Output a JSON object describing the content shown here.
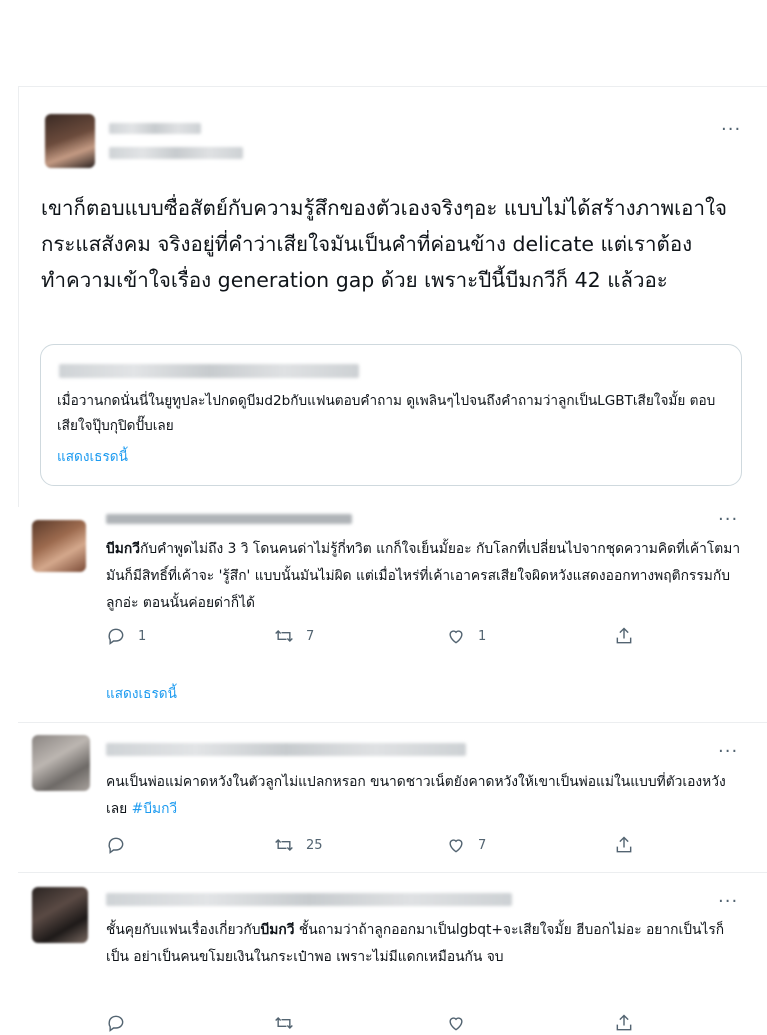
{
  "main_tweet": {
    "text": "เขาก็ตอบแบบซื่อสัตย์กับความรู้สึกของตัวเองจริงๆอะ แบบไม่ได้สร้างภาพเอาใจกระแสสังคม จริงอยู่ที่คำว่าเสียใจมันเป็นคำที่ค่อนข้าง delicate แต่เราต้องทำความเข้าใจเรื่อง generation gap ด้วย เพราะปีนี้บีมกวีก็ 42 แล้วอะ",
    "quote": {
      "text": "เมื่อวานกดนั่นนี่ในยูทูปละไปกดดูบีมd2bกับแฟนตอบคำถาม ดูเพลินๆไปจนถึงคำถามว่าลูกเป็นLGBTเสียใจมั้ย ตอบเสียใจปุ๊บกุปิดปั๊บเลย",
      "show_thread": "แสดงเธรดนี้"
    }
  },
  "replies": [
    {
      "prefix": "บีมกวี",
      "text": "กับคำพูดไม่ถึง 3 วิ โดนคนด่าไม่รู้กี่ทวิต แกก็ใจเย็นมั้ยอะ กับโลกที่เปลี่ยนไปจากชุดความคิดที่เค้าโตมา มันก็มีสิทธิ์ที่เค้าจะ 'รู้สึก' แบบนั้นมันไม่ผิด แต่เมื่อไหร่ที่เค้าเอาครสเสียใจผิดหวังแสดงออกทางพฤติกรรมกับลูกอ่ะ ตอนนั้นค่อยด่าก็ได้",
      "reply_count": "1",
      "retweet_count": "7",
      "like_count": "1",
      "show_thread": "แสดงเธรดนี้"
    },
    {
      "text": "คนเป็นพ่อแม่คาดหวังในตัวลูกไม่แปลกหรอก ขนาดชาวเน็ตยังคาดหวังให้เขาเป็นพ่อแม่ในแบบที่ตัวเองหวังเลย",
      "hashtag": "#บีมกวี",
      "reply_count": "",
      "retweet_count": "25",
      "like_count": "7"
    },
    {
      "before": "ชั้นคุยกับแฟนเรื่องเกี่ยวกับ",
      "bold": "บีมกวี",
      "after": " ชั้นถามว่าถ้าลูกออกมาเป็นlgbqt+จะเสียใจมั้ย ฮีบอกไม่อะ อยากเป็นไรก็เป็น อย่าเป็นคนขโมยเงินในกระเป๋าพอ เพราะไม่มีแดกเหมือนกัน จบ"
    }
  ],
  "icons": {
    "more": "more-icon",
    "reply": "reply-icon",
    "retweet": "retweet-icon",
    "like": "like-icon",
    "share": "share-icon"
  },
  "colors": {
    "accent": "#1d9bf0",
    "text": "#0f1419",
    "muted": "#536471",
    "border": "#cfd9de"
  }
}
